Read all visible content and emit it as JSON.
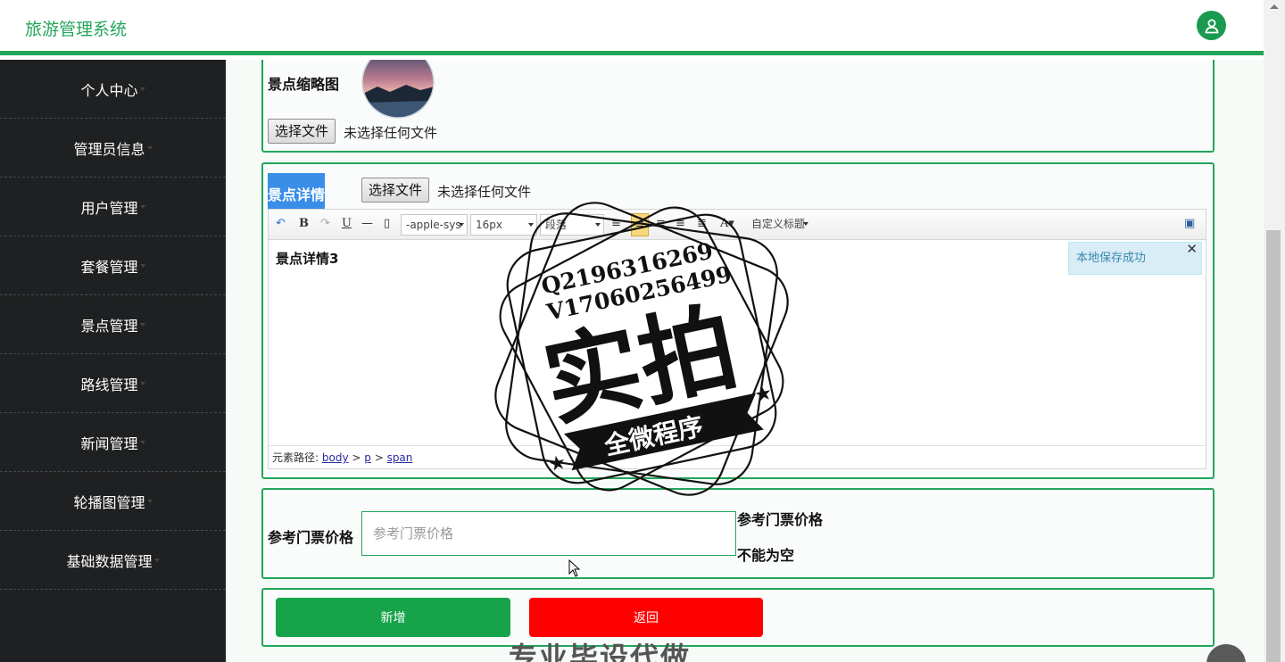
{
  "header": {
    "title": "旅游管理系统",
    "user_icon": "user-icon"
  },
  "sidebar": {
    "items": [
      {
        "label": "个人中心"
      },
      {
        "label": "管理员信息"
      },
      {
        "label": "用户管理"
      },
      {
        "label": "套餐管理"
      },
      {
        "label": "景点管理"
      },
      {
        "label": "路线管理"
      },
      {
        "label": "新闻管理"
      },
      {
        "label": "轮播图管理"
      },
      {
        "label": "基础数据管理"
      }
    ]
  },
  "thumbnail_card": {
    "label": "景点缩略图",
    "file_button": "选择文件",
    "file_status": "未选择任何文件"
  },
  "detail_card": {
    "label": "景点详情",
    "file_button": "选择文件",
    "file_status": "未选择任何文件",
    "editor": {
      "font_family": "-apple-sys",
      "font_size": "16px",
      "paragraph": "段落",
      "custom_title": "自定义标题",
      "content": "景点详情3",
      "toast": "本地保存成功",
      "path_label": "元素路径:",
      "path": [
        "body",
        "p",
        "span"
      ]
    }
  },
  "price_card": {
    "label": "参考门票价格",
    "placeholder": "参考门票价格",
    "error_line1": "参考门票价格",
    "error_line2": "不能为空"
  },
  "actions": {
    "add": "新增",
    "back": "返回"
  },
  "watermark": {
    "phone_q": "Q2196316269",
    "phone_v": "V17060256499",
    "main": "实拍",
    "banner": "全微程序",
    "bottom": "专业毕设代做"
  },
  "colors": {
    "accent": "#23a55a",
    "sidebar": "#1f2021",
    "add_button": "#16a34a",
    "back_button": "#ff0000"
  }
}
